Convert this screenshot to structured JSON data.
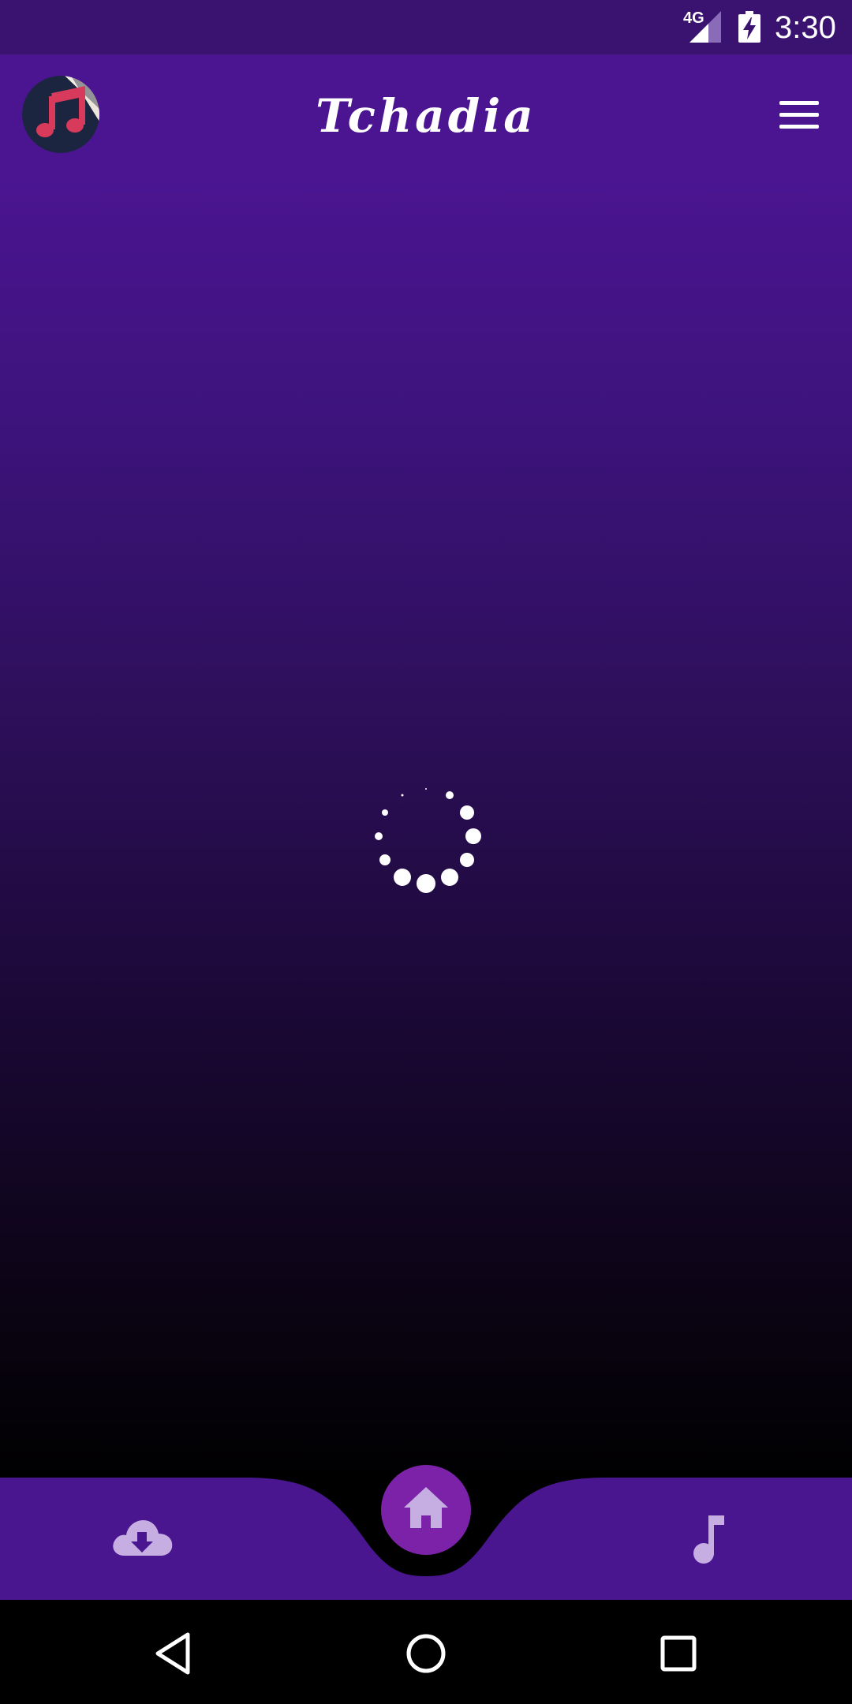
{
  "status_bar": {
    "network": "4G",
    "time": "3:30",
    "icons": [
      "signal-icon",
      "battery-charging-icon"
    ]
  },
  "app_bar": {
    "title": "Tchadia",
    "logo_icon": "music-note-icon",
    "menu_icon": "hamburger-menu-icon"
  },
  "content": {
    "loading_indicator": "spinner-dots"
  },
  "bottom_nav": {
    "items": [
      {
        "icon": "cloud-download-icon"
      },
      {
        "icon": "home-icon",
        "active": true
      },
      {
        "icon": "music-note-icon"
      }
    ]
  },
  "system_nav": {
    "buttons": [
      "back-icon",
      "home-circle-icon",
      "recents-icon"
    ]
  },
  "colors": {
    "primary": "#4b1591",
    "accent": "#7b22a8",
    "logo_background": "#1b2540",
    "logo_note": "#d83a5c"
  }
}
